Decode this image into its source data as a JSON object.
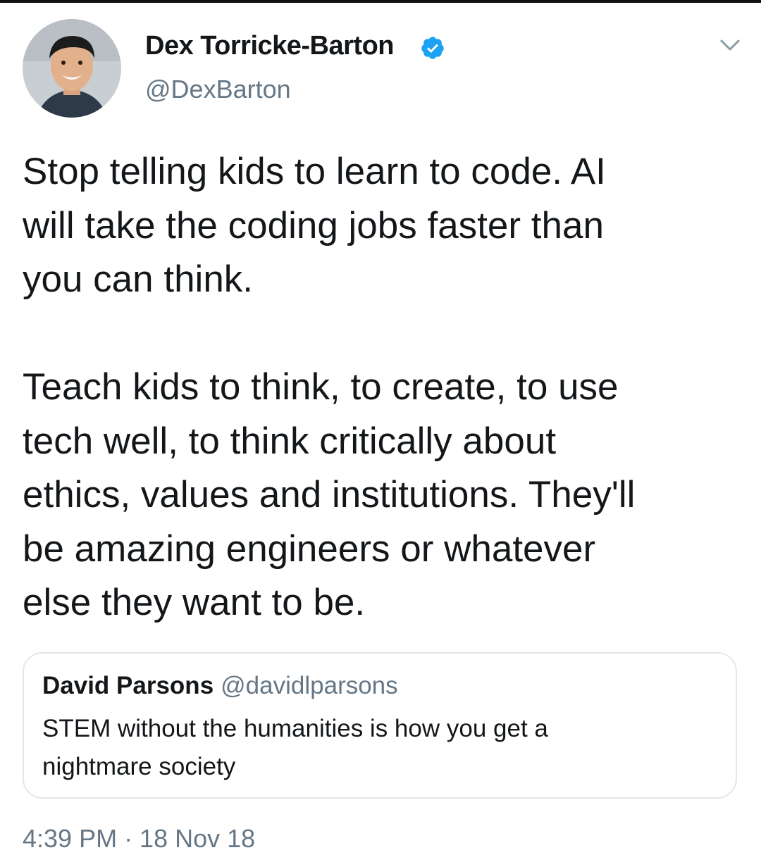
{
  "author": {
    "display_name": "Dex Torricke-Barton",
    "handle": "@DexBarton",
    "verified_icon": "verified-badge-icon",
    "avatar_icon": "avatar-photo"
  },
  "tweet": {
    "paragraph1_lines": [
      "Stop telling kids to learn to code. AI",
      "will take the coding jobs faster than",
      "you can think."
    ],
    "paragraph2_lines": [
      "Teach kids to think, to create, to use",
      "tech well, to think critically about",
      "ethics, values and institutions. They'll",
      "be amazing engineers or whatever",
      "else they want to be."
    ]
  },
  "quoted_tweet": {
    "name": "David Parsons",
    "handle": "@davidlparsons",
    "text_lines": [
      "STEM without the humanities is how you get a",
      "nightmare society"
    ]
  },
  "timestamp": "4:39 PM · 18 Nov 18",
  "colors": {
    "text": "#14171a",
    "secondary": "#657786",
    "verified": "#1da1f2",
    "border": "#e1e8ed"
  }
}
